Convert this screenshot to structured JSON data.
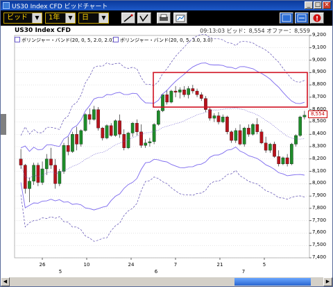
{
  "window": {
    "title": "US30 Index CFD ビッドチャート",
    "controls": [
      "_",
      "□",
      "×"
    ]
  },
  "toolbar": {
    "price_type": "ビッド",
    "period": "1年",
    "interval": "日",
    "tools": [
      "trendline-tool-icon",
      "measure-tool-icon",
      "print-icon",
      "export-icon"
    ],
    "alert": "!"
  },
  "chart_header": {
    "title": "US30 Index CFD",
    "info": "09:13:03  ビッド：8,554  オファー：8,559"
  },
  "legend": [
    {
      "text": "ボリンジャー・バンド(20, 0, 5, 2.0, 2.0)",
      "color": "#6a5acd"
    },
    {
      "text": "ボリンジャー・バンド(20, 0, 5, 3.0, 3.0)",
      "color": "#6a5acd"
    }
  ],
  "last_price": "8,554",
  "chart_data": {
    "type": "candlestick",
    "y_axis": {
      "min": 7400,
      "max": 9200,
      "ticks": [
        "9,200",
        "9,100",
        "9,000",
        "8,900",
        "8,800",
        "8,700",
        "8,600",
        "8,500",
        "8,400",
        "8,300",
        "8,200",
        "8,100",
        "8,000",
        "7,900",
        "7,800",
        "7,700",
        "7,600",
        "7,500",
        "7,400"
      ]
    },
    "x_axis": {
      "day_labels": [
        "26",
        "10",
        "24",
        "7",
        "21",
        "5"
      ],
      "month_labels": [
        "5",
        "6",
        "7"
      ]
    },
    "candles": [
      [
        8200,
        8280,
        8120,
        8150
      ],
      [
        8150,
        8160,
        7920,
        7960
      ],
      [
        7960,
        8050,
        7850,
        8020
      ],
      [
        8020,
        8170,
        7990,
        8150
      ],
      [
        8150,
        8170,
        7980,
        8010
      ],
      [
        8010,
        8180,
        7990,
        8120
      ],
      [
        8120,
        8240,
        8070,
        8200
      ],
      [
        8200,
        8290,
        8120,
        8150
      ],
      [
        8150,
        8200,
        7960,
        8000
      ],
      [
        8000,
        8120,
        7980,
        8100
      ],
      [
        8100,
        8330,
        8080,
        8310
      ],
      [
        8310,
        8380,
        8230,
        8260
      ],
      [
        8260,
        8420,
        8250,
        8400
      ],
      [
        8400,
        8460,
        8270,
        8320
      ],
      [
        8320,
        8440,
        8300,
        8430
      ],
      [
        8430,
        8570,
        8420,
        8560
      ],
      [
        8560,
        8610,
        8480,
        8520
      ],
      [
        8520,
        8630,
        8510,
        8600
      ],
      [
        8600,
        8620,
        8430,
        8450
      ],
      [
        8450,
        8460,
        8350,
        8370
      ],
      [
        8370,
        8480,
        8360,
        8470
      ],
      [
        8470,
        8490,
        8380,
        8390
      ],
      [
        8390,
        8520,
        8380,
        8510
      ],
      [
        8510,
        8560,
        8370,
        8400
      ],
      [
        8400,
        8440,
        8270,
        8290
      ],
      [
        8290,
        8420,
        8280,
        8410
      ],
      [
        8410,
        8500,
        8380,
        8490
      ],
      [
        8490,
        8520,
        8390,
        8420
      ],
      [
        8420,
        8480,
        8290,
        8310
      ],
      [
        8310,
        8360,
        8290,
        8330
      ],
      [
        8330,
        8370,
        8300,
        8340
      ],
      [
        8340,
        8490,
        8320,
        8480
      ],
      [
        8480,
        8600,
        8470,
        8590
      ],
      [
        8590,
        8730,
        8580,
        8720
      ],
      [
        8720,
        8760,
        8640,
        8660
      ],
      [
        8660,
        8760,
        8650,
        8750
      ],
      [
        8750,
        8790,
        8700,
        8740
      ],
      [
        8740,
        8780,
        8690,
        8760
      ],
      [
        8760,
        8790,
        8700,
        8720
      ],
      [
        8720,
        8790,
        8690,
        8770
      ],
      [
        8770,
        8800,
        8730,
        8750
      ],
      [
        8750,
        8770,
        8700,
        8720
      ],
      [
        8720,
        8740,
        8670,
        8690
      ],
      [
        8690,
        8710,
        8580,
        8600
      ],
      [
        8600,
        8620,
        8510,
        8530
      ],
      [
        8530,
        8570,
        8500,
        8550
      ],
      [
        8550,
        8580,
        8480,
        8500
      ],
      [
        8500,
        8560,
        8490,
        8540
      ],
      [
        8540,
        8550,
        8400,
        8420
      ],
      [
        8420,
        8430,
        8330,
        8350
      ],
      [
        8350,
        8450,
        8330,
        8430
      ],
      [
        8430,
        8480,
        8310,
        8320
      ],
      [
        8320,
        8460,
        8300,
        8450
      ],
      [
        8450,
        8480,
        8380,
        8400
      ],
      [
        8400,
        8490,
        8390,
        8480
      ],
      [
        8480,
        8530,
        8400,
        8420
      ],
      [
        8420,
        8440,
        8320,
        8330
      ],
      [
        8330,
        8380,
        8250,
        8270
      ],
      [
        8270,
        8330,
        8250,
        8320
      ],
      [
        8320,
        8340,
        8210,
        8220
      ],
      [
        8220,
        8270,
        8140,
        8160
      ],
      [
        8160,
        8220,
        8150,
        8210
      ],
      [
        8210,
        8240,
        8140,
        8160
      ],
      [
        8160,
        8330,
        8150,
        8320
      ],
      [
        8320,
        8400,
        8300,
        8390
      ],
      [
        8390,
        8550,
        8380,
        8540
      ],
      [
        8540,
        8590,
        8520,
        8554
      ]
    ]
  },
  "scrollbar": {
    "left_arrow": "◀",
    "right_arrow": "▶"
  }
}
